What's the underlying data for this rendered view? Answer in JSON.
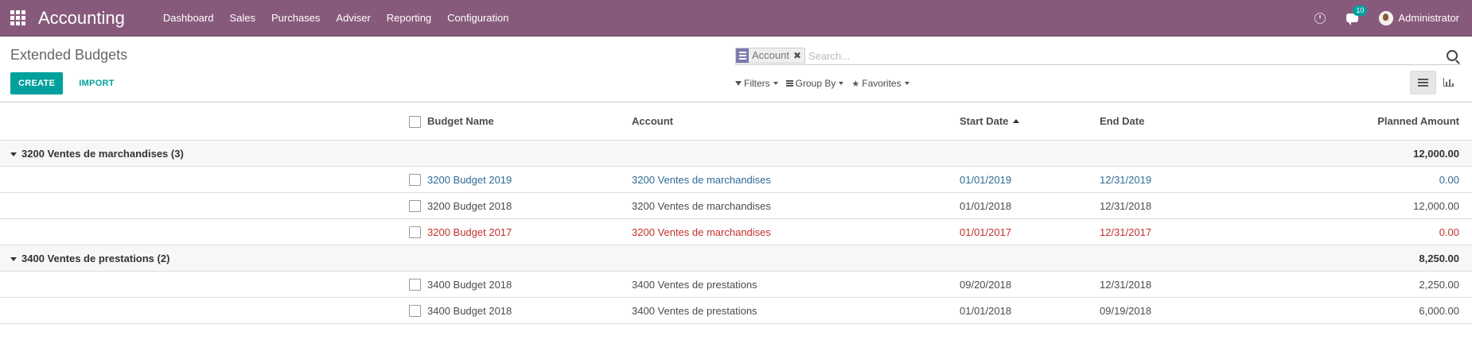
{
  "navbar": {
    "brand": "Accounting",
    "menu": [
      "Dashboard",
      "Sales",
      "Purchases",
      "Adviser",
      "Reporting",
      "Configuration"
    ],
    "notification_count": "10",
    "user_name": "Administrator",
    "color": "#875a7b"
  },
  "control_panel": {
    "breadcrumb": "Extended Budgets",
    "create_label": "CREATE",
    "import_label": "IMPORT",
    "search": {
      "facet_label": "Account",
      "facet_remove": "✖",
      "placeholder": "Search..."
    },
    "filters_label": "Filters",
    "group_by_label": "Group By",
    "favorites_label": "Favorites"
  },
  "table": {
    "columns": {
      "name": "Budget Name",
      "account": "Account",
      "start_date": "Start Date",
      "end_date": "End Date",
      "planned_amount": "Planned Amount"
    },
    "groups": [
      {
        "label": "3200 Ventes de marchandises (3)",
        "total": "12,000.00",
        "rows": [
          {
            "name": "3200 Budget 2019",
            "account": "3200 Ventes de marchandises",
            "start": "01/01/2019",
            "end": "12/31/2019",
            "amount": "0.00",
            "status": "info"
          },
          {
            "name": "3200 Budget 2018",
            "account": "3200 Ventes de marchandises",
            "start": "01/01/2018",
            "end": "12/31/2018",
            "amount": "12,000.00",
            "status": "normal"
          },
          {
            "name": "3200 Budget 2017",
            "account": "3200 Ventes de marchandises",
            "start": "01/01/2017",
            "end": "12/31/2017",
            "amount": "0.00",
            "status": "danger"
          }
        ]
      },
      {
        "label": "3400 Ventes de prestations (2)",
        "total": "8,250.00",
        "rows": [
          {
            "name": "3400 Budget 2018",
            "account": "3400 Ventes de prestations",
            "start": "09/20/2018",
            "end": "12/31/2018",
            "amount": "2,250.00",
            "status": "normal"
          },
          {
            "name": "3400 Budget 2018",
            "account": "3400 Ventes de prestations",
            "start": "01/01/2018",
            "end": "09/19/2018",
            "amount": "6,000.00",
            "status": "normal"
          }
        ]
      }
    ]
  }
}
